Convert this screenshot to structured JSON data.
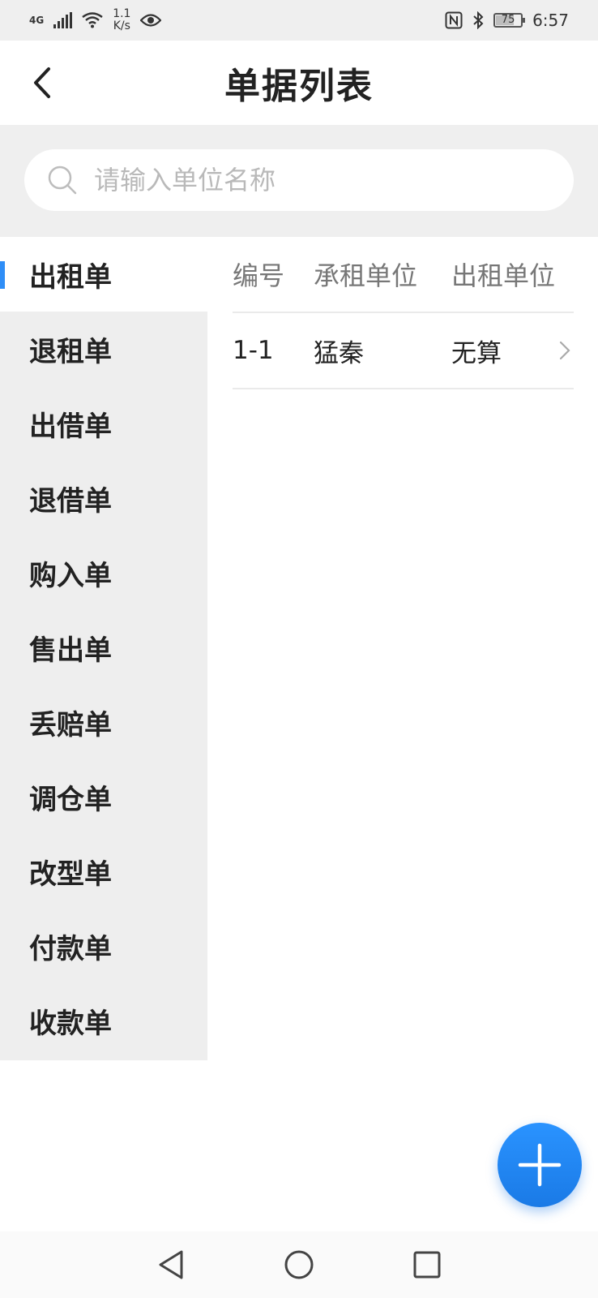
{
  "status_bar": {
    "network_type": "4G",
    "net_speed_value": "1.1",
    "net_speed_unit": "K/s",
    "battery": "75",
    "battery_level": 0.75,
    "time": "6:57"
  },
  "header": {
    "title": "单据列表"
  },
  "search": {
    "placeholder": "请输入单位名称"
  },
  "sidebar": {
    "items": [
      {
        "label": "出租单",
        "active": true
      },
      {
        "label": "退租单",
        "active": false
      },
      {
        "label": "出借单",
        "active": false
      },
      {
        "label": "退借单",
        "active": false
      },
      {
        "label": "购入单",
        "active": false
      },
      {
        "label": "售出单",
        "active": false
      },
      {
        "label": "丢赔单",
        "active": false
      },
      {
        "label": "调仓单",
        "active": false
      },
      {
        "label": "改型单",
        "active": false
      },
      {
        "label": "付款单",
        "active": false
      },
      {
        "label": "收款单",
        "active": false
      }
    ]
  },
  "table": {
    "columns": [
      "编号",
      "承租单位",
      "出租单位"
    ],
    "rows": [
      {
        "id": "1-1",
        "lessee": "猛秦",
        "lessor": "无算"
      }
    ]
  },
  "colors": {
    "accent": "#2f8ef7",
    "fab": "#1f86f2",
    "sidebar_bg": "#eeeeee"
  },
  "icons": {
    "back": "chevron-left-icon",
    "search": "search-icon",
    "row_arrow": "chevron-right-icon",
    "fab": "plus-icon",
    "nav_back": "triangle-back-icon",
    "nav_home": "circle-home-icon",
    "nav_recent": "square-recent-icon"
  }
}
